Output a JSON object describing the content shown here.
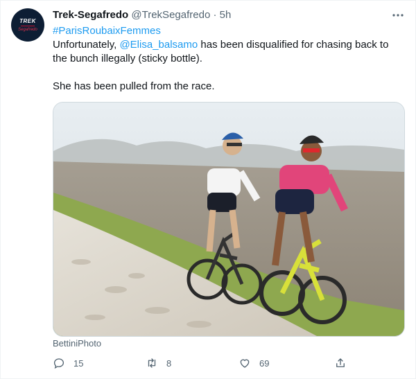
{
  "tweet": {
    "author_name": "Trek-Segafredo",
    "handle": "@TrekSegafredo",
    "separator": "·",
    "time": "5h",
    "avatar": {
      "logo_top": "TREK",
      "logo_sub": "Segafredo"
    },
    "text": {
      "hashtag": "#ParisRoubaixFemmes",
      "line2_prefix": "Unfortunately, ",
      "mention": "@Elisa_balsamo",
      "line2_suffix": " has been disqualified for chasing back to",
      "line3": "the bunch illegally (sticky bottle).",
      "line5": "She has been pulled from the race."
    },
    "media_credit": "BettiniPhoto",
    "actions": {
      "reply_count": "15",
      "retweet_count": "8",
      "like_count": "69"
    }
  },
  "icons": {
    "more": "more-horizontal-icon",
    "reply": "reply-icon",
    "retweet": "retweet-icon",
    "like": "heart-icon",
    "share": "share-icon"
  },
  "colors": {
    "link": "#1d9bf0",
    "secondary_text": "#536471",
    "border": "#cfd9de",
    "avatar_bg": "#0d1e34"
  }
}
